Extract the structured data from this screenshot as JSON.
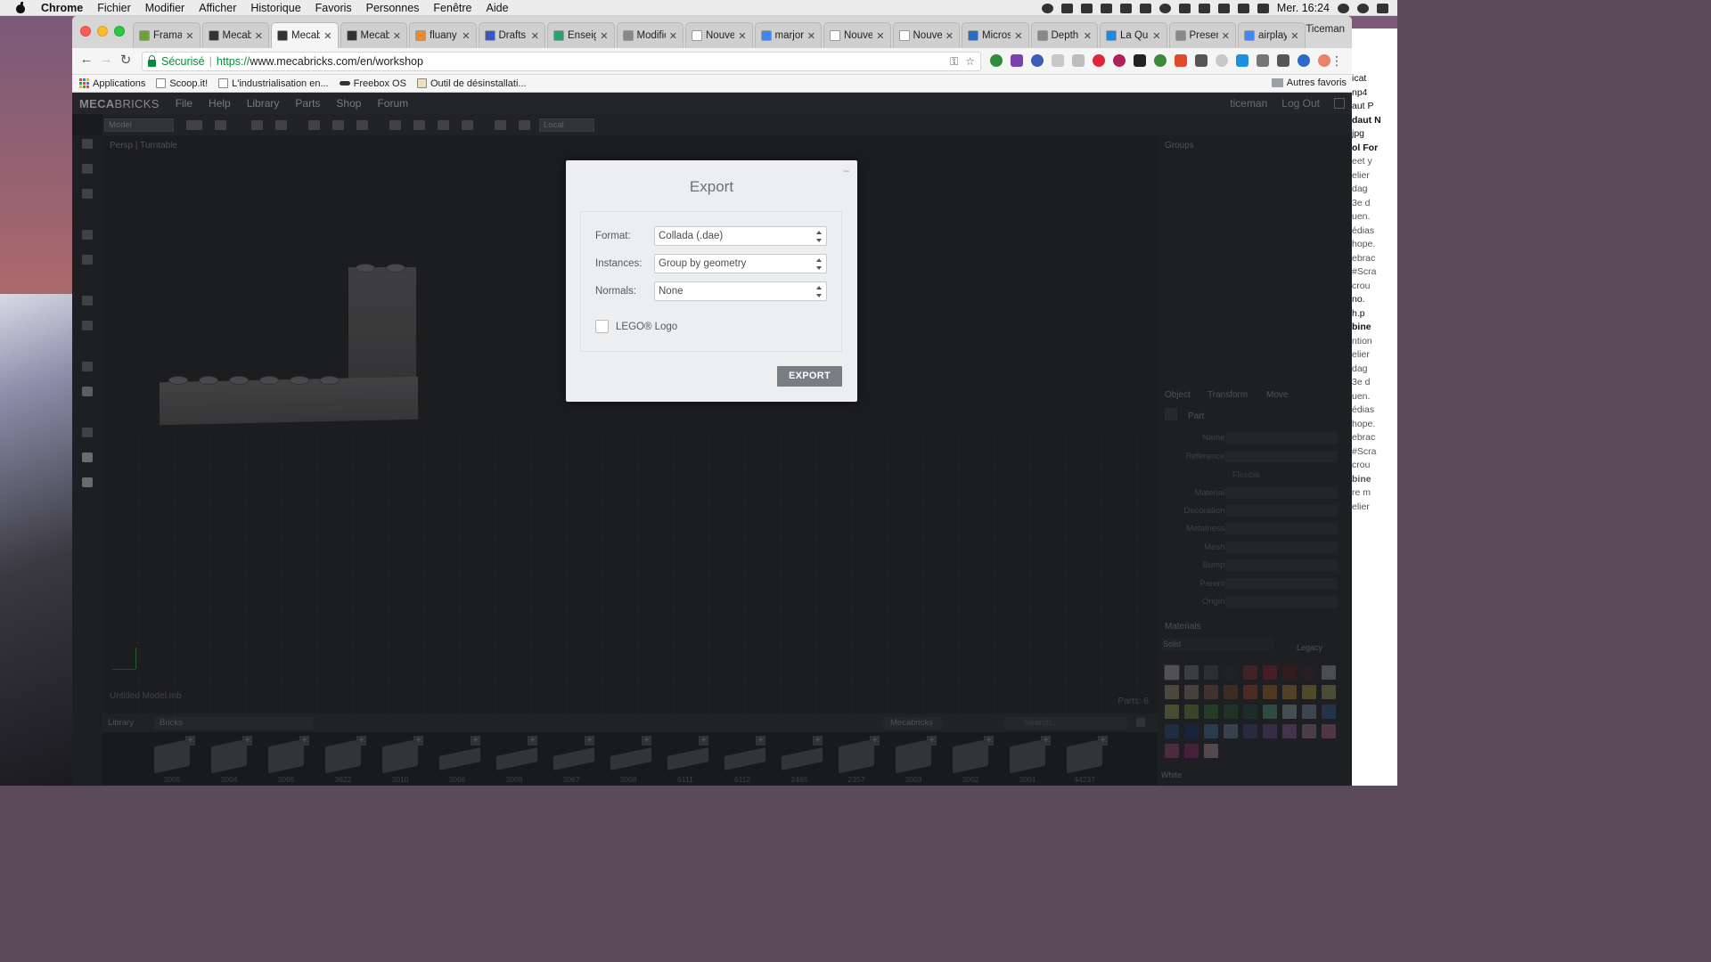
{
  "menubar": {
    "app": "Chrome",
    "items": [
      "Fichier",
      "Modifier",
      "Afficher",
      "Historique",
      "Favoris",
      "Personnes",
      "Fenêtre",
      "Aide"
    ],
    "clock": "Mer. 16:24"
  },
  "browser": {
    "profile": "Ticeman",
    "tabs": [
      {
        "label": "Frama",
        "color": "#6ca23a"
      },
      {
        "label": "Mecab",
        "color": "#333333"
      },
      {
        "label": "Mecab",
        "color": "#333333"
      },
      {
        "label": "Mecab",
        "color": "#333333"
      },
      {
        "label": "fluany",
        "color": "#e98a2c"
      },
      {
        "label": "Drafts",
        "color": "#3d54c4"
      },
      {
        "label": "Enseig",
        "color": "#2aa36e"
      },
      {
        "label": "Modific",
        "color": "#888888"
      },
      {
        "label": "Nouvel on",
        "color": "#ffffff"
      },
      {
        "label": "marjori",
        "color": "#4285f4"
      },
      {
        "label": "Nouvel on",
        "color": "#ffffff"
      },
      {
        "label": "Nouvel on",
        "color": "#ffffff"
      },
      {
        "label": "Micros",
        "color": "#2b6cc4"
      },
      {
        "label": "Depth",
        "color": "#888888"
      },
      {
        "label": "La Qua",
        "color": "#1e88e5"
      },
      {
        "label": "Presen",
        "color": "#888888"
      },
      {
        "label": "airplay",
        "color": "#4285f4"
      }
    ],
    "active_tab": 2,
    "secure_label": "Sécurisé",
    "url_protocol": "https://",
    "url_rest": "www.mecabricks.com/en/workshop",
    "bookmarks": [
      "Applications",
      "Scoop.it!",
      "L'industrialisation en...",
      "Freebox OS",
      "Outil de désinstallati..."
    ],
    "other_bookmarks": "Autres favoris"
  },
  "app": {
    "brand_bold": "MECA",
    "brand_rest": "BRICKS",
    "menu": [
      "File",
      "Help",
      "Library",
      "Parts",
      "Shop",
      "Forum"
    ],
    "user": "ticeman",
    "logout": "Log Out",
    "mode_select": "Model",
    "space_select": "Local",
    "viewport_label": "Persp | Turntable",
    "file_name": "Untitled Model.mb",
    "parts_count": "Parts: 6",
    "right_panel": {
      "groups_tab": "Groups",
      "tabs": [
        "Object",
        "Transform",
        "Move"
      ],
      "section": "Part",
      "fields": [
        "Name:",
        "Reference:",
        "Material:",
        "Decoration:",
        "Metalness:",
        "Mesh:",
        "Bump:",
        "Parent:",
        "Origin:"
      ],
      "flexible": "Flexible",
      "materials_title": "Materials",
      "materials_filter": "Solid",
      "legacy": "Legacy",
      "current_color": "White",
      "swatches": [
        "#f2f2f2",
        "#9aa0a6",
        "#5a6068",
        "#2a2b2e",
        "#b02a2a",
        "#d0142a",
        "#6a1a1a",
        "#4a1a2a",
        "#e0e0e0",
        "#d8c88a",
        "#c8b090",
        "#b07850",
        "#9a5a30",
        "#e05a28",
        "#f28a20",
        "#f8b030",
        "#f2d040",
        "#d8e070",
        "#c8e060",
        "#88c040",
        "#3a9a3a",
        "#2a6a3a",
        "#1a5a4a",
        "#6ad0b0",
        "#c0e8f0",
        "#a0c0e0",
        "#3a78c8",
        "#1a58a8",
        "#0a3a88",
        "#4a9ad8",
        "#8ab0d8",
        "#5a4aa0",
        "#8a5ac0",
        "#c07ad0",
        "#e0a0c8",
        "#f080a0",
        "#e050a0",
        "#c02a80",
        "#f8c8d8"
      ]
    },
    "library": {
      "label": "Library",
      "category": "Bricks",
      "source": "Mecabricks",
      "search_placeholder": "Search...",
      "parts": [
        "3005",
        "3004",
        "3065",
        "3622",
        "3010",
        "3066",
        "3009",
        "3067",
        "3008",
        "6111",
        "6112",
        "2465",
        "2357",
        "3003",
        "3002",
        "3001",
        "44237"
      ]
    }
  },
  "export_dialog": {
    "title": "Export",
    "close": "–",
    "format_label": "Format:",
    "format_value": "Collada (.dae)",
    "instances_label": "Instances:",
    "instances_value": "Group by geometry",
    "normals_label": "Normals:",
    "normals_value": "None",
    "lego_logo_label": "LEGO® Logo",
    "lego_logo_checked": false,
    "export_button": "EXPORT"
  },
  "background_window": {
    "lines": [
      "icat",
      "np4",
      "aut P",
      "daut N",
      "jpg",
      "ol For",
      "eet y",
      "elier",
      "dag",
      "3e d",
      "uen.",
      "édias",
      "hope.",
      "ebrac",
      "#Scra",
      "crou",
      "no.",
      "h.p",
      "bine",
      "ntion",
      "elier",
      "dag",
      "3e d",
      "uen.",
      "édias",
      "hope.",
      "ebrac",
      "#Scra",
      "crou",
      "bine",
      "re m",
      "elier"
    ]
  }
}
